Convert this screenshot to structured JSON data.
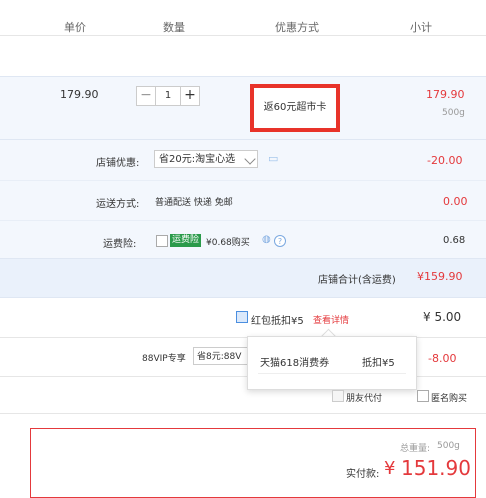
{
  "header": {
    "col_price": "单价",
    "col_qty": "数量",
    "col_promo": "优惠方式",
    "col_subtotal": "小计"
  },
  "item": {
    "unit_price": "179.90",
    "quantity": "1",
    "minus": "−",
    "plus": "+",
    "promo": "返60元超市卡",
    "subtotal": "179.90",
    "weight": "500g"
  },
  "shop": {
    "discount_label": "店铺优惠:",
    "discount_select": "省20元:淘宝心选",
    "discount_value": "-20.00",
    "shipping_label": "运送方式:",
    "shipping_value": "普通配送 快递 免邮",
    "shipping_price": "0.00",
    "insurance_label": "运费险:",
    "insurance_tag": "运费险",
    "insurance_text": "¥0.68购买",
    "insurance_price": "0.68",
    "total_label": "店铺合计(含运费)",
    "total_value": "¥159.90"
  },
  "redpacket": {
    "label": "红包抵扣¥5",
    "link": "查看详情",
    "value": "¥ 5.00"
  },
  "vip": {
    "label": "88VIP专享",
    "select": "省8元:88V",
    "value": "-8.00"
  },
  "popup": {
    "coupon": "天猫618消费券",
    "deduct": "抵扣¥5"
  },
  "options": {
    "friend_pay": "朋友代付",
    "anonymous": "匿名购买"
  },
  "summary": {
    "weight_label": "总重量:",
    "weight_value": "500g",
    "pay_label": "实付款:",
    "currency": "¥",
    "pay_value": "151.90"
  },
  "colors": {
    "accent_red": "#e4393c",
    "promo_border": "#e8332a",
    "row_bg": "#f3f7fd"
  }
}
